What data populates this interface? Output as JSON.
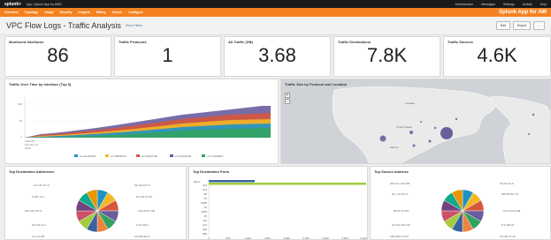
{
  "topbar": {
    "logo": "splunk>",
    "app": "App: Splunk App for AWS",
    "right_items": [
      "Administrator",
      "Messages",
      "Settings",
      "Activity",
      "Help"
    ]
  },
  "nav": {
    "items": [
      "Overview",
      "Topology",
      "Usage",
      "Security",
      "Insights",
      "Billing",
      "Search",
      "Configure"
    ],
    "brand": "Splunk App for AW"
  },
  "page": {
    "title": "VPC Flow Logs - Traffic Analysis",
    "edit_link": "Show Filters",
    "edit_button": "Edit",
    "export_button": "Export",
    "more_button": "..."
  },
  "kpis": [
    {
      "title": "Monitored Interfaces",
      "value": "86"
    },
    {
      "title": "Traffic Protocols",
      "value": "1"
    },
    {
      "title": "All Traffic (GB)",
      "value": "3.68"
    },
    {
      "title": "Traffic Destinations",
      "value": "7.8K"
    },
    {
      "title": "Traffic Sources",
      "value": "4.6K"
    }
  ],
  "traffic_over_time": {
    "title": "Traffic Over Time by Interface (Top 5)",
    "x_ticks": [
      "2:00 PM Tue Nov 11 2016",
      "",
      "",
      "",
      "",
      "",
      "",
      "",
      ""
    ],
    "y_ticks": [
      "100",
      "10",
      "1"
    ],
    "legend": [
      "eni-2e10a491",
      "eni-986f1bd2",
      "eni-bd0b7c6a",
      "eni-6142b2d4",
      "eni-e7d4a810"
    ],
    "colors": [
      "#1e93c6",
      "#f2b827",
      "#d6563c",
      "#6a5c9e",
      "#31a35f"
    ]
  },
  "map": {
    "title": "Traffic Size by Protocol and Location",
    "zoom_in": "+",
    "zoom_out": "−",
    "labels": [
      "Canada",
      "United States",
      "Mexico"
    ]
  },
  "dest_addresses": {
    "title": "Top Destination Addresses",
    "left_labels": [
      "107.20.217.0",
      "8.181.10.1",
      "203.106.157.5",
      "91.233.12.1",
      "141.2.0.88"
    ],
    "right_labels": [
      "52.224.154.5",
      "54.193.10.58",
      "130.25.97.203",
      "5.46.218.1",
      "104.85.98.11"
    ],
    "slice_colors": [
      "#1e93c6",
      "#f2b827",
      "#d6563c",
      "#6a5c9e",
      "#31a35f",
      "#ed8440",
      "#3863a0",
      "#a2cc3e",
      "#cc5068",
      "#73427f",
      "#11a88b",
      "#ea9600"
    ]
  },
  "dest_ports": {
    "title": "Top Destination Ports",
    "series_label": "Bytes",
    "y_labels": [
      "Others",
      "443",
      "123",
      "80",
      "53",
      "8080",
      "22",
      "3389",
      "25",
      "110",
      "143",
      "993",
      "995"
    ],
    "x_ticks": [
      "0",
      "500",
      "1,000",
      "1,500",
      "2,000",
      "2,500",
      "3,000",
      "3,500",
      "4,000"
    ],
    "bar_value_others": 1200,
    "bar_value_443": 4000
  },
  "source_address": {
    "title": "Top Source Address",
    "left_labels": [
      "202.117.149.155",
      "54.1.15.96.17",
      "85.84.72.151",
      "10.213.163.132",
      "186.188.174.33"
    ],
    "right_labels": [
      "91.211.12.9",
      "185.65.96.173",
      "101.164.10.88",
      "5.3.218.44",
      "18.126.73.40"
    ],
    "slice_colors": [
      "#1e93c6",
      "#f2b827",
      "#d6563c",
      "#6a5c9e",
      "#31a35f",
      "#ed8440",
      "#3863a0",
      "#a2cc3e",
      "#cc5068",
      "#73427f",
      "#11a88b",
      "#ea9600"
    ]
  }
}
